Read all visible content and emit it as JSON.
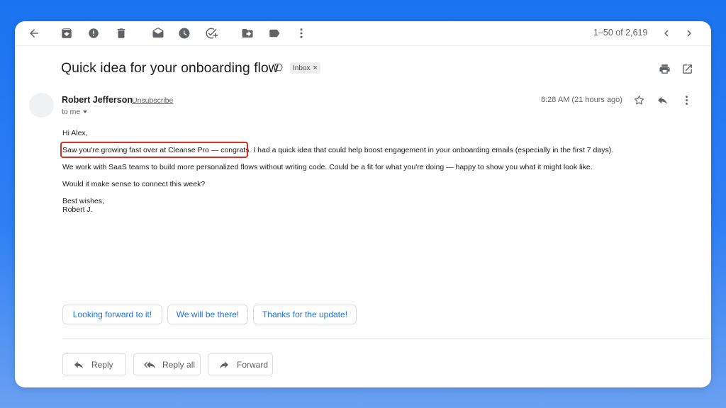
{
  "toolbar": {
    "icons": [
      "back-arrow-icon",
      "archive-icon",
      "report-spam-icon",
      "delete-icon",
      "mark-unread-icon",
      "snooze-icon",
      "add-task-icon",
      "move-to-icon",
      "label-icon",
      "more-vert-icon"
    ],
    "pagination": "1–50 of 2,619"
  },
  "email": {
    "subject": "Quick idea for your onboarding flow",
    "label": "Inbox",
    "label_close": "×",
    "sender": "Robert Jefferson",
    "unsubscribe": "Unsubscribe",
    "to": "to me",
    "time": "8:28 AM (21 hours ago)",
    "body": {
      "greeting": "Hi Alex,",
      "line1_highlight": "Saw you're growing fast over at Cleanse Pro — congrats.",
      "line1_rest": " I had a quick idea that could help boost engagement in your onboarding emails (especially in the first 7 days).",
      "line2": "We work with SaaS teams to build more personalized flows without writing code. Could be a fit for what you're doing — happy to show you what it might look like.",
      "line3": "Would it make sense to connect this week?",
      "signoff": "Best wishes,",
      "signature": "Robert J."
    }
  },
  "smart_replies": [
    "Looking forward to it!",
    "We will be there!",
    "Thanks for the update!"
  ],
  "actions": {
    "reply": "Reply",
    "reply_all": "Reply all",
    "forward": "Forward"
  },
  "colors": {
    "accent": "#1a73e8",
    "highlight_border": "#d93025",
    "background": "#1a73f0"
  }
}
